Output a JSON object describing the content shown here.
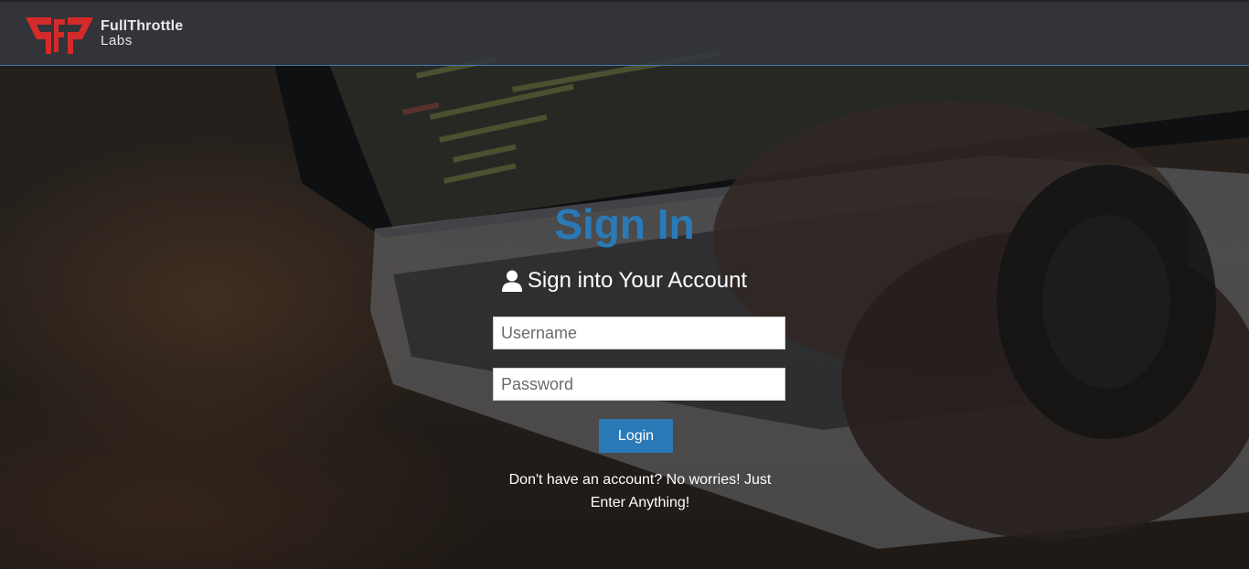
{
  "brand": {
    "name_line1": "FullThrottle",
    "name_line2": "Labs",
    "logo_icon": "fullthrottle-logo-icon",
    "logo_color": "#d42a2a"
  },
  "colors": {
    "accent": "#2a7ab8",
    "navbar_bg": "#34383e"
  },
  "signin": {
    "title": "Sign In",
    "subtitle": "Sign into Your Account",
    "subtitle_icon": "user-icon",
    "username_placeholder": "Username",
    "password_placeholder": "Password",
    "login_label": "Login",
    "note": "Don't have an account? No worries! Just Enter Anything!"
  }
}
